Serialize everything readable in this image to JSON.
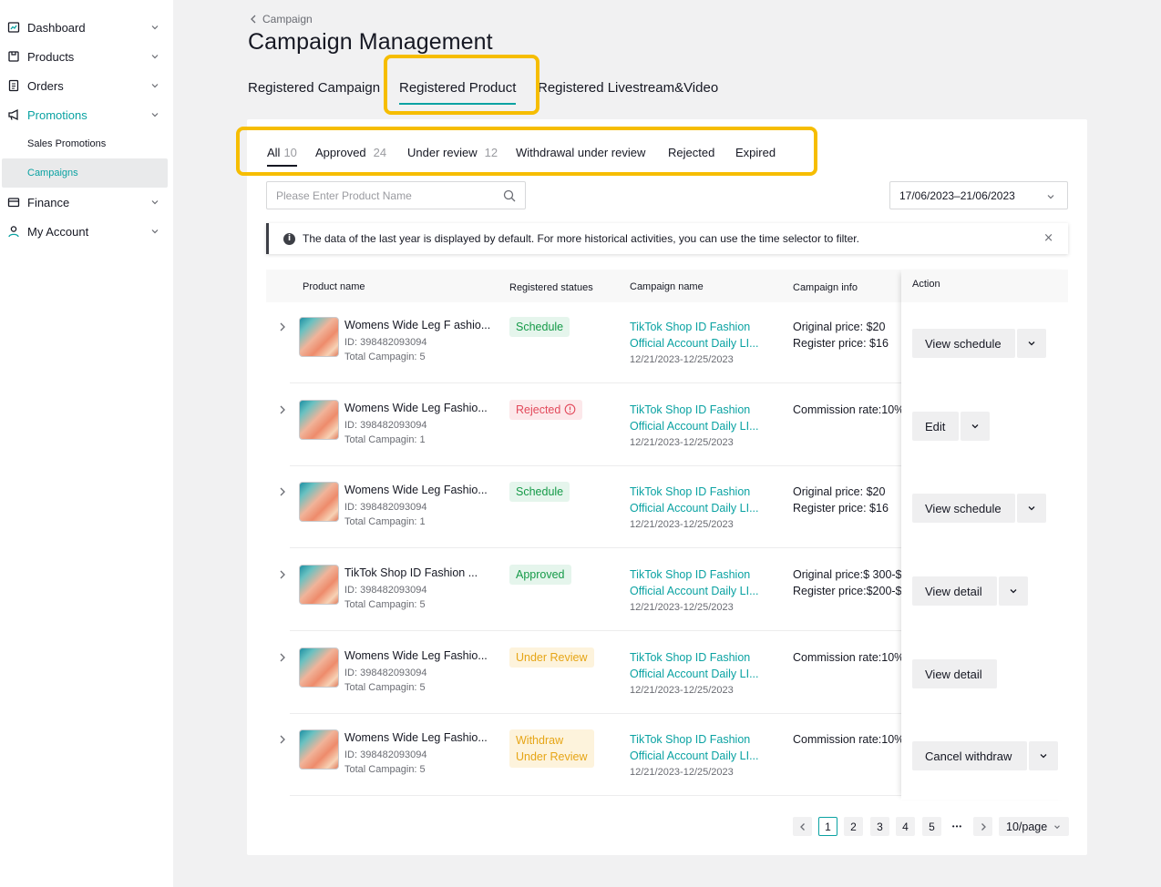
{
  "sidebar": {
    "items": [
      {
        "label": "Dashboard",
        "icon": "dashboard-icon"
      },
      {
        "label": "Products",
        "icon": "products-icon"
      },
      {
        "label": "Orders",
        "icon": "orders-icon"
      },
      {
        "label": "Promotions",
        "icon": "megaphone-icon",
        "active": true
      },
      {
        "label": "Finance",
        "icon": "finance-icon"
      },
      {
        "label": "My Account",
        "icon": "user-icon"
      }
    ],
    "promotions_sub": [
      "Sales Promotions",
      "Campaigns"
    ]
  },
  "header": {
    "breadcrumb": "Campaign",
    "title": "Campaign Management",
    "tabs": [
      "Registered Campaign",
      "Registered Product",
      "Registered Livestream&Video"
    ]
  },
  "filters": {
    "sub_tabs": [
      {
        "label": "All",
        "count": "10"
      },
      {
        "label": "Approved",
        "count": "24"
      },
      {
        "label": "Under review",
        "count": "12"
      },
      {
        "label": "Withdrawal under review",
        "count": ""
      },
      {
        "label": "Rejected",
        "count": ""
      },
      {
        "label": "Expired",
        "count": ""
      }
    ],
    "search_placeholder": "Please Enter Product Name",
    "date_range": "17/06/2023–21/06/2023"
  },
  "notice": {
    "text": "The data of the last year is displayed by default. For more historical activities, you can use the time selector to filter.",
    "close": "×"
  },
  "table": {
    "headers": [
      "Product name",
      "Registered statues",
      "Campaign name",
      "Campaign info",
      "Action"
    ],
    "rows": [
      {
        "product": "Womens Wide Leg F ashio...",
        "id": "ID: 398482093094",
        "total": "Total Campagin: 5",
        "status": "Schedule",
        "campaign_line1": "TikTok Shop ID Fashion",
        "campaign_line2": "Official Account Daily LI...",
        "dates": "12/21/2023-12/25/2023",
        "info_line1": "Original price:  $20",
        "info_line2": "Register price: $16",
        "action": "View schedule"
      },
      {
        "product": "Womens Wide Leg Fashio...",
        "id": "ID: 398482093094",
        "total": "Total Campagin: 1",
        "status": "Rejected",
        "campaign_line1": "TikTok Shop ID Fashion",
        "campaign_line2": "Official Account Daily LI...",
        "dates": "12/21/2023-12/25/2023",
        "info_line1": "Commission rate:10%",
        "info_line2": "",
        "action": "Edit"
      },
      {
        "product": "Womens Wide Leg Fashio...",
        "id": "ID: 398482093094",
        "total": "Total Campagin: 1",
        "status": "Schedule",
        "campaign_line1": "TikTok Shop ID Fashion",
        "campaign_line2": "Official Account Daily LI...",
        "dates": "12/21/2023-12/25/2023",
        "info_line1": "Original price:  $20",
        "info_line2": "Register price: $16",
        "action": "View schedule"
      },
      {
        "product": "TikTok Shop ID Fashion ...",
        "id": "ID: 398482093094",
        "total": "Total Campagin: 5",
        "status": "Approved",
        "campaign_line1": "TikTok Shop ID Fashion",
        "campaign_line2": "Official Account Daily LI...",
        "dates": "12/21/2023-12/25/2023",
        "info_line1": "Original price:$ 300-$",
        "info_line2": "Register price:$200-$",
        "action": "View detail"
      },
      {
        "product": "Womens Wide Leg Fashio...",
        "id": "ID: 398482093094",
        "total": "Total Campagin: 5",
        "status": "Under Review",
        "campaign_line1": "TikTok Shop ID Fashion",
        "campaign_line2": "Official Account Daily LI...",
        "dates": "12/21/2023-12/25/2023",
        "info_line1": "Commission rate:10%",
        "info_line2": "",
        "action": "View detail"
      },
      {
        "product": "Womens Wide Leg Fashio...",
        "id": "ID: 398482093094",
        "total": "Total Campagin: 5",
        "status_line1": "Withdraw",
        "status_line2": "Under Review",
        "campaign_line1": "TikTok Shop ID Fashion",
        "campaign_line2": "Official Account Daily LI...",
        "dates": "12/21/2023-12/25/2023",
        "info_line1": "Commission rate:10%",
        "info_line2": "",
        "action": "Cancel withdraw"
      }
    ]
  },
  "pagination": {
    "pages": [
      "1",
      "2",
      "3",
      "4",
      "5"
    ],
    "current": "1",
    "ellipsis": "•••",
    "per_page": "10/page"
  },
  "colors": {
    "accent": "#0aa2a2",
    "highlight": "#f6bd00",
    "status_green": "#159a48",
    "status_red": "#e2495b",
    "status_orange": "#e6a516"
  }
}
